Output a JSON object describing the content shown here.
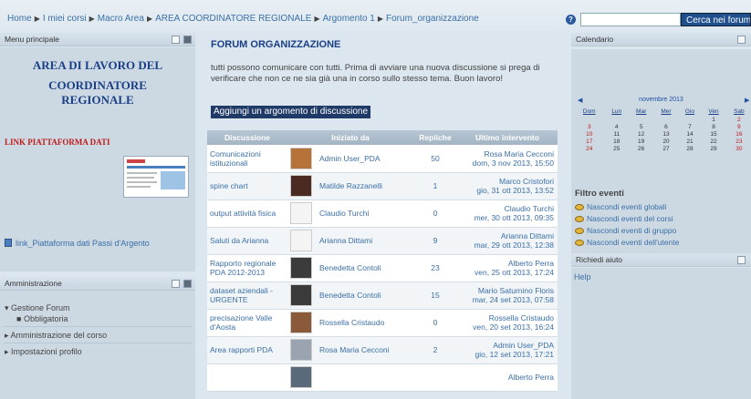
{
  "breadcrumb": [
    "Home",
    "I miei corsi",
    "Macro Area",
    "AREA COORDINATORE REGIONALE",
    "Argomento 1",
    "Forum_organizzazione"
  ],
  "header": {
    "search_placeholder": "",
    "search_button": "Cerca nei forum"
  },
  "left": {
    "menu_title": "Menu principale",
    "area_title": [
      "AREA DI LAVORO DEL",
      "COORDINATORE",
      "REGIONALE"
    ],
    "link_platform": "LINK PIATTAFORMA DATI",
    "file_link": "link_Piattaforma dati Passi d'Argento",
    "admin_title": "Amministrazione",
    "admin_items": [
      "Gestione Forum",
      "Obbligatoria",
      "Amministrazione del corso",
      "Impostazioni profilo"
    ]
  },
  "main": {
    "title": "FORUM ORGANIZZAZIONE",
    "intro": "tutti possono comunicare con tutti. Prima di avviare una nuova discussione si prega di verificare che non ce ne sia già una in corso sullo stesso tema. Buon lavoro!",
    "add_button": "Aggiungi un argomento di discussione",
    "columns": [
      "Discussione",
      "Iniziato da",
      "Repliche",
      "Ultimo intervento"
    ],
    "rows": [
      {
        "topic": "Comunicazioni istituzionali",
        "author": "Admin User_PDA",
        "replies": "50",
        "last_by": "Rosa Maria Cecconi",
        "last_date": "dom, 3 nov 2013, 15:50",
        "avatar_color": "#b5733a"
      },
      {
        "topic": "spine chart",
        "author": "Matilde Razzanelli",
        "replies": "1",
        "last_by": "Marco Cristofori",
        "last_date": "gio, 31 ott 2013, 13:52",
        "avatar_color": "#4a2a22"
      },
      {
        "topic": "output attività fisica",
        "author": "Claudio Turchi",
        "replies": "0",
        "last_by": "Claudio Turchi",
        "last_date": "mer, 30 ott 2013, 09:35",
        "avatar_color": ""
      },
      {
        "topic": "Saluti da Arianna",
        "author": "Arianna Dittami",
        "replies": "9",
        "last_by": "Arianna Dittami",
        "last_date": "mar, 29 ott 2013, 12:38",
        "avatar_color": ""
      },
      {
        "topic": "Rapporto regionale PDA 2012-2013",
        "author": "Benedetta Contoli",
        "replies": "23",
        "last_by": "Alberto Perra",
        "last_date": "ven, 25 ott 2013, 17:24",
        "avatar_color": "#3b3b3b"
      },
      {
        "topic": "dataset aziendali - URGENTE",
        "author": "Benedetta Contoli",
        "replies": "15",
        "last_by": "Mario Saturnino Floris",
        "last_date": "mar, 24 set 2013, 07:58",
        "avatar_color": "#3b3b3b"
      },
      {
        "topic": "precisazione Valle d'Aosta",
        "author": "Rossella Cristaudo",
        "replies": "0",
        "last_by": "Rossella Cristaudo",
        "last_date": "ven, 20 set 2013, 16:24",
        "avatar_color": "#8a5a3a"
      },
      {
        "topic": "Area rapporti PDA",
        "author": "Rosa Maria Cecconi",
        "replies": "2",
        "last_by": "Admin User_PDA",
        "last_date": "gio, 12 set 2013, 17:21",
        "avatar_color": "#9aa3b0"
      },
      {
        "topic": "",
        "author": "",
        "replies": "",
        "last_by": "Alberto Perra",
        "last_date": "",
        "avatar_color": "#5a6a7a"
      }
    ]
  },
  "right": {
    "calendar_title": "Calendario",
    "month": "novembre 2013",
    "weekdays": [
      "Dom",
      "Lun",
      "Mar",
      "Mer",
      "Gio",
      "Ven",
      "Sab"
    ],
    "weeks": [
      [
        "",
        "",
        "",
        "",
        "",
        "1",
        "2"
      ],
      [
        "3",
        "4",
        "5",
        "6",
        "7",
        "8",
        "9"
      ],
      [
        "10",
        "11",
        "12",
        "13",
        "14",
        "15",
        "16"
      ],
      [
        "17",
        "18",
        "19",
        "20",
        "21",
        "22",
        "23"
      ],
      [
        "24",
        "25",
        "26",
        "27",
        "28",
        "29",
        "30"
      ]
    ],
    "filter_title": "Filtro eventi",
    "filters": [
      "Nascondi eventi globali",
      "Nascondi eventi del corsi",
      "Nascondi eventi di gruppo",
      "Nascondi eventi dell'utente"
    ],
    "help_title": "Richiedi aiuto",
    "help_link": "Help"
  },
  "colors": {
    "link": "#3b6fa6",
    "title": "#1b3f86",
    "accent_red": "#c21a1a",
    "button": "#1f4f8c"
  }
}
